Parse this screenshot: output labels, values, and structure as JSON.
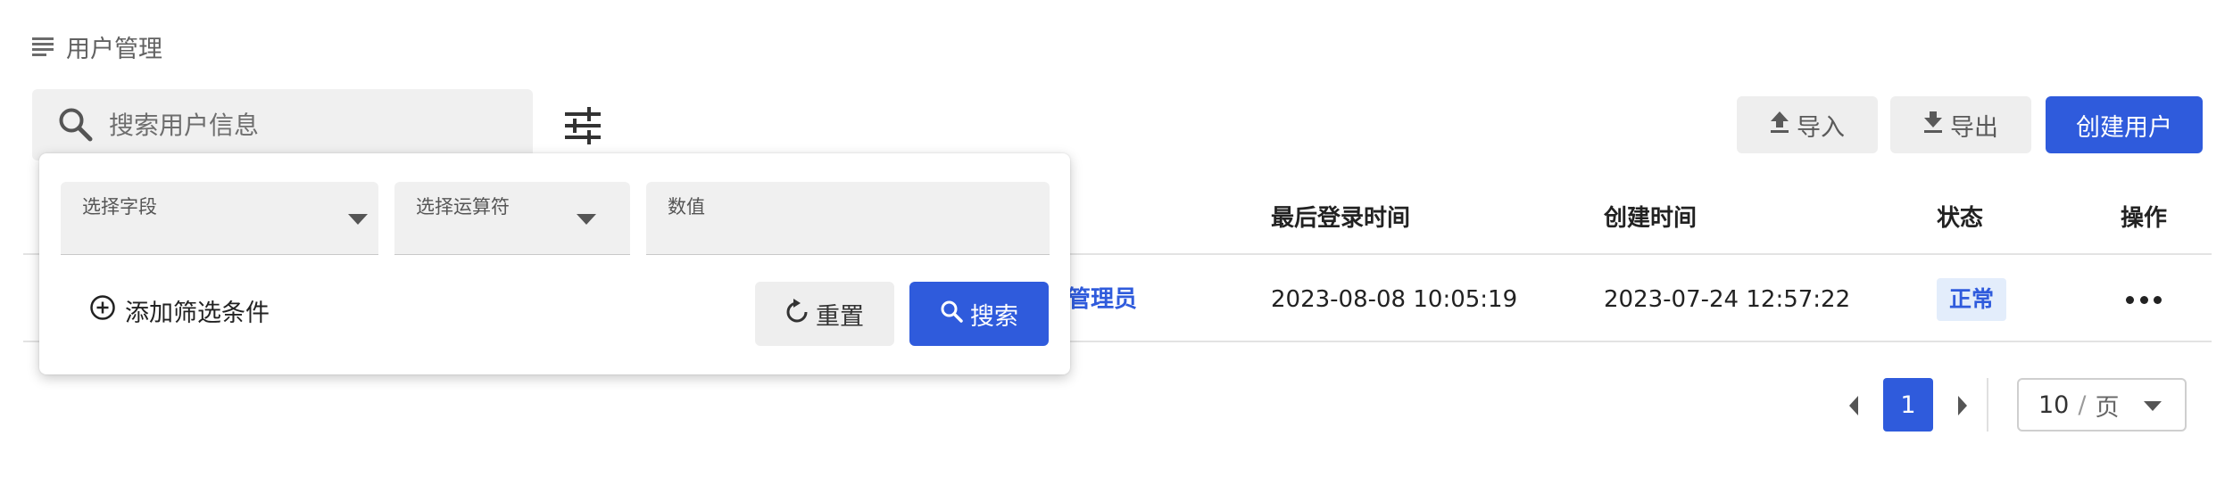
{
  "page": {
    "title": "用户管理"
  },
  "search": {
    "placeholder": "搜索用户信息"
  },
  "toolbar": {
    "import_label": "导入",
    "export_label": "导出",
    "create_label": "创建用户"
  },
  "table": {
    "columns": {
      "last_login": "最后登录时间",
      "created": "创建时间",
      "status": "状态",
      "actions": "操作"
    },
    "rows": [
      {
        "role_partial": "管理员",
        "last_login": "2023-08-08 10:05:19",
        "created": "2023-07-24 12:57:22",
        "status": "正常"
      }
    ]
  },
  "pagination": {
    "current": "1",
    "page_size": "10",
    "page_size_sep": "/",
    "page_size_unit": "页"
  },
  "filter": {
    "field_label": "选择字段",
    "operator_label": "选择运算符",
    "value_label": "数值",
    "add_condition": "添加筛选条件",
    "reset": "重置",
    "search": "搜索"
  },
  "colors": {
    "primary": "#2f5bdc",
    "badge_bg": "#e3edfb"
  },
  "icons": [
    "list-icon",
    "search-icon",
    "filter-sliders-icon",
    "upload-icon",
    "download-icon",
    "more-icon",
    "chevron-left-icon",
    "chevron-right-icon",
    "caret-down-icon",
    "plus-circle-icon",
    "refresh-icon"
  ]
}
